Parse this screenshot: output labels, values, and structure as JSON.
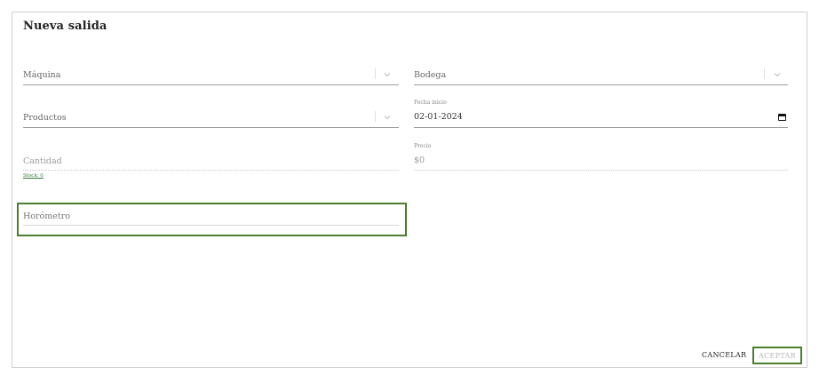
{
  "dialog": {
    "title": "Nueva salida"
  },
  "form": {
    "maquina": {
      "placeholder": "Máquina"
    },
    "bodega": {
      "placeholder": "Bodega"
    },
    "productos": {
      "placeholder": "Productos"
    },
    "fecha_inicio": {
      "label": "Fecha inicio",
      "value": "02-01-2024"
    },
    "cantidad": {
      "placeholder": "Cantidad",
      "stock_link": "Stock: 0"
    },
    "precio": {
      "label": "Precio",
      "value": "$0"
    },
    "horometro": {
      "placeholder": "Horómetro"
    }
  },
  "actions": {
    "cancel_label": "CANCELAR",
    "accept_label": "ACEPTAR"
  },
  "colors": {
    "focus_border": "#4b7f2f",
    "stock_link": "#2e7d32"
  },
  "icons": [
    "chevron-down-icon",
    "calendar-icon"
  ]
}
